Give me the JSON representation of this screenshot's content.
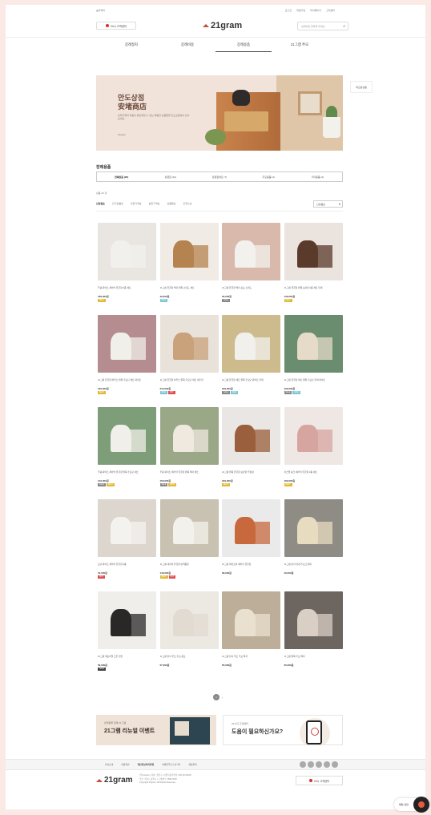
{
  "top_bar": {
    "left": "숲블케어",
    "links": [
      "로그인",
      "회원가입",
      "마이페이지",
      "고객센터"
    ]
  },
  "header": {
    "call_button": "24시 고객센터",
    "logo_text": "21gram",
    "search_placeholder": "검색어를 입력해 주세요"
  },
  "gnb": [
    "장례절차",
    "장례비용",
    "장례용품",
    "21그램 추모"
  ],
  "banner": {
    "title_kr": "안도상점",
    "title_hanja": "安堵商店",
    "desc": "반려가족의 마음이 편안해질 수 있는 특별한 상품들을 안도상점에서 만나보세요.",
    "brand": "21gram"
  },
  "side_button": "최근본상품",
  "section": {
    "title": "장례용품",
    "tabs": [
      "전체상품 (25)",
      "유골함 (12)",
      "유골함세트 (7)",
      "추모용품 (4)",
      "기타용품 (2)"
    ],
    "count": "상품 25 개",
    "sort": [
      "신상품순",
      "인기상품순",
      "낮은가격순",
      "높은가격순",
      "상품평순",
      "조회수순"
    ],
    "select": "신상품순"
  },
  "products": [
    {
      "name": "무광 화이트 세라믹 유골함 2종 세트",
      "price": "189,000원",
      "badges": [
        {
          "t": "BEST",
          "c": "#e3b935"
        }
      ],
      "img": {
        "bg": "#e9e6e2",
        "o": "#f2f0ec"
      }
    },
    {
      "name": "21그램 유골함 액자 원목 스탠드 세트",
      "price": "49,000원",
      "badges": [
        {
          "t": "NEW",
          "c": "#7cc5d6"
        }
      ],
      "img": {
        "bg": "#f0ebe5",
        "o": "#b5834f"
      }
    },
    {
      "name": "21그램 유골함 액자 포토 스탠드",
      "price": "29,000원",
      "badges": [
        {
          "t": "SALE",
          "c": "#888"
        }
      ],
      "img": {
        "bg": "#d9b9ab",
        "o": "#f3f1ed"
      }
    },
    {
      "name": "21그램 유골함 원목 보관함 2종 세트 블랙",
      "price": "139,000원",
      "badges": [
        {
          "t": "BEST",
          "c": "#e3b935"
        }
      ],
      "img": {
        "bg": "#ebe3de",
        "o": "#5a3a2a"
      }
    },
    {
      "name": "21그램 유골함 하우스 원목 추모단 세트 화이트",
      "price": "169,000원",
      "badges": [
        {
          "t": "BEST",
          "c": "#e3b935"
        }
      ],
      "img": {
        "bg": "#b58c8f",
        "o": "#f1efe9"
      }
    },
    {
      "name": "21그램 유골함 하우스 원목 추모단 세트 내추럴",
      "price": "219,000원",
      "badges": [
        {
          "t": "NEW",
          "c": "#7cc5d6"
        },
        {
          "t": "HOT",
          "c": "#e04f4f"
        }
      ],
      "img": {
        "bg": "#e8e2da",
        "o": "#c9a27b"
      }
    },
    {
      "name": "21그램 유골함 세트 원목 추모단 화이트 블랙",
      "price": "229,000원",
      "badges": [
        {
          "t": "SALE",
          "c": "#888"
        },
        {
          "t": "NEW",
          "c": "#7cc5d6"
        }
      ],
      "img": {
        "bg": "#cdbb8e",
        "o": "#f2f0ec"
      }
    },
    {
      "name": "21그램 유골함 세트 원목 추모단 블랙 화이트",
      "price": "199,000원",
      "badges": [
        {
          "t": "SALE",
          "c": "#888"
        },
        {
          "t": "NEW",
          "c": "#7cc5d6"
        }
      ],
      "img": {
        "bg": "#6a8c6f",
        "o": "#e6dbc8"
      }
    },
    {
      "name": "무광 화이트 세라믹 유골함 원목 추모단 세트",
      "price": "149,000원",
      "badges": [
        {
          "t": "SALE",
          "c": "#888"
        },
        {
          "t": "BEST",
          "c": "#e3b935"
        }
      ],
      "img": {
        "bg": "#7e9e7a",
        "o": "#f1efea"
      }
    },
    {
      "name": "무광 화이트 세라믹 유골함 원목 액자 세트",
      "price": "159,000원",
      "badges": [
        {
          "t": "SALE",
          "c": "#888"
        },
        {
          "t": "BEST",
          "c": "#e3b935"
        }
      ],
      "img": {
        "bg": "#9aa888",
        "o": "#efe9df"
      }
    },
    {
      "name": "21그램 원목 유골함 보관함 뚜껑형",
      "price": "249,000원",
      "badges": [
        {
          "t": "BEST",
          "c": "#e3b935"
        }
      ],
      "img": {
        "bg": "#eae6e3",
        "o": "#9a5f3c"
      }
    },
    {
      "name": "파스텔 핑크 세라믹 유골함 2종 세트",
      "price": "189,000원",
      "badges": [
        {
          "t": "BEST",
          "c": "#e3b935"
        }
      ],
      "img": {
        "bg": "#efe7e4",
        "o": "#d7a5a0"
      }
    },
    {
      "name": "모던 화이트 세라믹 유골함 2종",
      "price": "79,000원",
      "badges": [
        {
          "t": "HOT",
          "c": "#e04f4f"
        }
      ],
      "img": {
        "bg": "#ddd6ce",
        "o": "#f4f2ee"
      }
    },
    {
      "name": "21그램 대리석 유골함 반려동물",
      "price": "149,000원",
      "badges": [
        {
          "t": "BEST",
          "c": "#e3b935"
        },
        {
          "t": "HOT",
          "c": "#e04f4f"
        }
      ],
      "img": {
        "bg": "#c9c1b2",
        "o": "#f3f1ec"
      }
    },
    {
      "name": "21그램 테라코타 세라믹 유골함",
      "price": "99,000원",
      "badges": [],
      "img": {
        "bg": "#eaeaea",
        "o": "#c7693d"
      }
    },
    {
      "name": "21그램 천사 날개 추모 트레이",
      "price": "49,000원",
      "badges": [],
      "img": {
        "bg": "#8f8c86",
        "o": "#e8dcc0"
      }
    },
    {
      "name": "21그램 메모리얼 스톤 캔들",
      "price": "59,000원",
      "badges": [
        {
          "t": "SALE",
          "c": "#444"
        }
      ],
      "img": {
        "bg": "#f0eeea",
        "o": "#2a2827"
      }
    },
    {
      "name": "21그램 천사 부조 추모 큐브",
      "price": "57,000원",
      "badges": [],
      "img": {
        "bg": "#ece8e2",
        "o": "#e1dbd1"
      }
    },
    {
      "name": "21그램 천사 부조 추모 액자",
      "price": "55,000원",
      "badges": [],
      "img": {
        "bg": "#bcae99",
        "o": "#e9e0cf"
      }
    },
    {
      "name": "21그램 원목 추모 액자",
      "price": "35,000원",
      "badges": [],
      "img": {
        "bg": "#6c6560",
        "o": "#d9cfc5"
      }
    }
  ],
  "pager": {
    "current": "1",
    "next": "›"
  },
  "promo_left": {
    "sub": "반려동물 장례 21그램",
    "title": "21그램 리뉴얼 이벤트"
  },
  "promo_right": {
    "sub": "24시간 고객센터",
    "title": "도움이 필요하신가요?"
  },
  "footer": {
    "links": [
      "회사소개",
      "이용약관",
      "개인정보처리방침",
      "이메일무단수집거부",
      "제휴문의"
    ],
    "logo_text": "21gram",
    "info": [
      "(주)21gram | 대표: 권신구 | 사업자등록번호: 000-00-00000",
      "주소: 경기도 광주시 | 고객센터: 1588-0000",
      "Copyright 21gram. All Rights Reserved."
    ],
    "call_button": "24시 고객센터"
  },
  "chat": {
    "label": "채팅 상담"
  }
}
